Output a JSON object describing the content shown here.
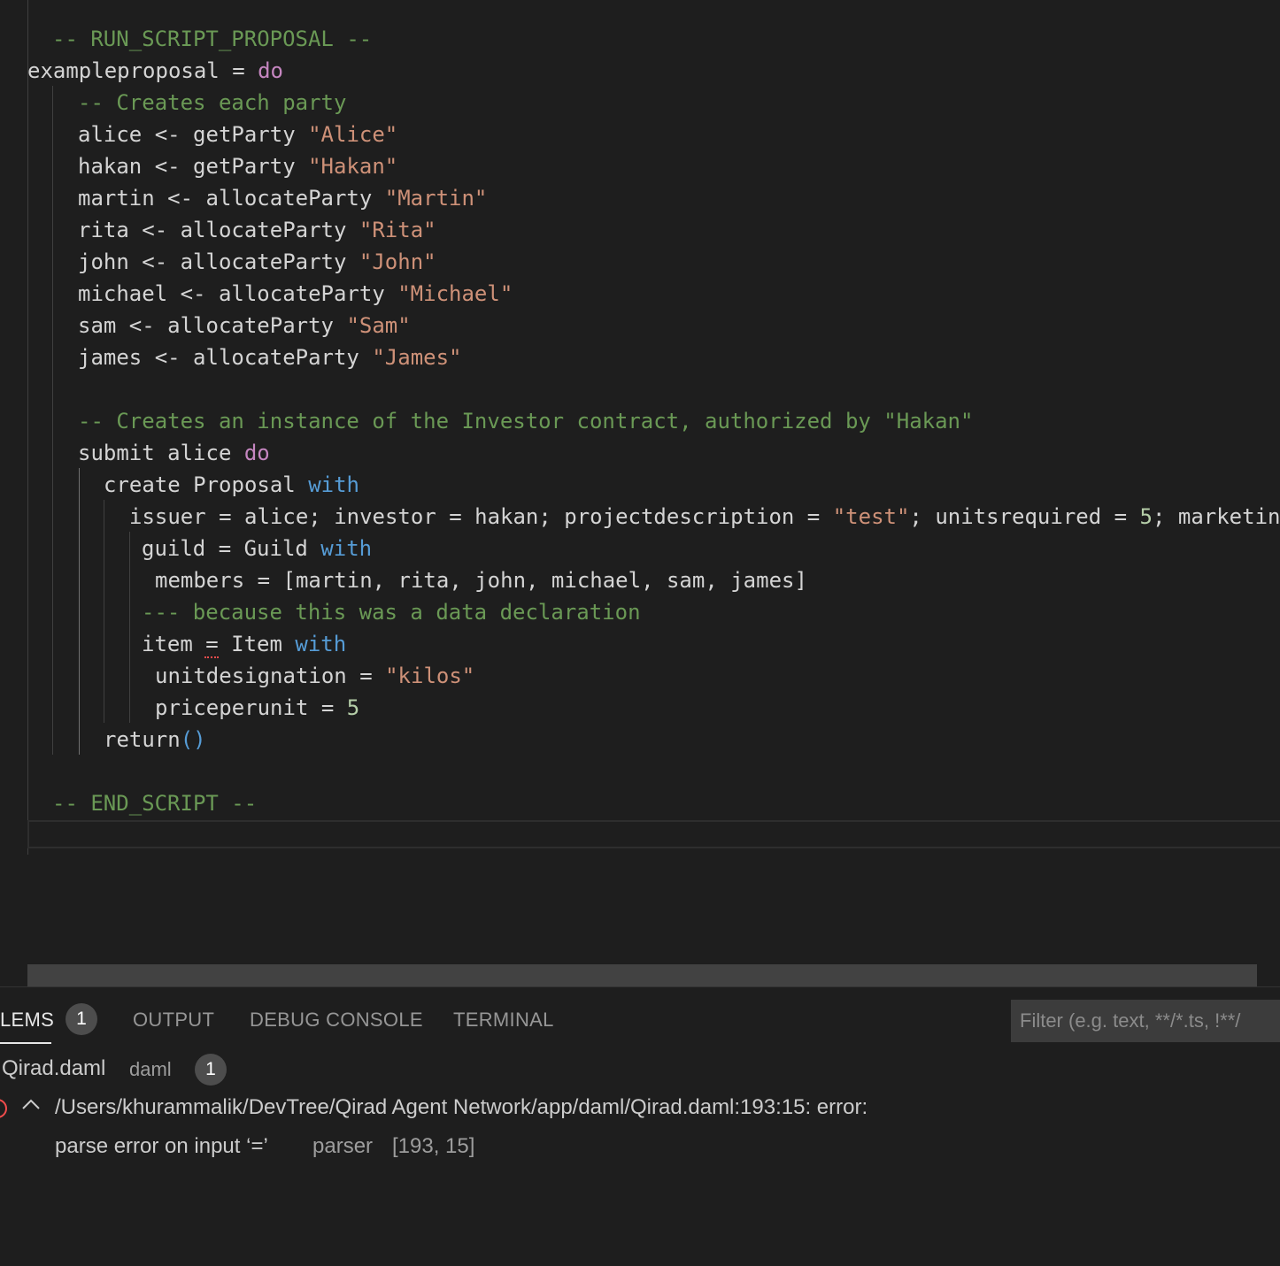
{
  "editor": {
    "lines": [
      {
        "segments": [
          {
            "t": "-- RUN_SCRIPT_PROPOSAL --",
            "c": "c"
          }
        ]
      },
      {
        "segments": [
          {
            "t": "exampleproposal = ",
            "c": ""
          },
          {
            "t": "do",
            "c": "kw"
          }
        ]
      },
      {
        "segments": [
          {
            "t": "-- Creates each party",
            "c": "c"
          }
        ]
      },
      {
        "segments": [
          {
            "t": "alice <- getParty ",
            "c": ""
          },
          {
            "t": "\"Alice\"",
            "c": "s"
          }
        ]
      },
      {
        "segments": [
          {
            "t": "hakan <- getParty ",
            "c": ""
          },
          {
            "t": "\"Hakan\"",
            "c": "s"
          }
        ]
      },
      {
        "segments": [
          {
            "t": "martin <- allocateParty ",
            "c": ""
          },
          {
            "t": "\"Martin\"",
            "c": "s"
          }
        ]
      },
      {
        "segments": [
          {
            "t": "rita <- allocateParty ",
            "c": ""
          },
          {
            "t": "\"Rita\"",
            "c": "s"
          }
        ]
      },
      {
        "segments": [
          {
            "t": "john <- allocateParty ",
            "c": ""
          },
          {
            "t": "\"John\"",
            "c": "s"
          }
        ]
      },
      {
        "segments": [
          {
            "t": "michael <- allocateParty ",
            "c": ""
          },
          {
            "t": "\"Michael\"",
            "c": "s"
          }
        ]
      },
      {
        "segments": [
          {
            "t": "sam <- allocateParty ",
            "c": ""
          },
          {
            "t": "\"Sam\"",
            "c": "s"
          }
        ]
      },
      {
        "segments": [
          {
            "t": "james <- allocateParty ",
            "c": ""
          },
          {
            "t": "\"James\"",
            "c": "s"
          }
        ]
      },
      {
        "segments": []
      },
      {
        "segments": [
          {
            "t": "-- Creates an instance of the Investor contract, authorized by \"Hakan\"",
            "c": "c"
          }
        ]
      },
      {
        "segments": [
          {
            "t": "submit alice ",
            "c": ""
          },
          {
            "t": "do",
            "c": "kw"
          }
        ]
      },
      {
        "segments": [
          {
            "t": "create Proposal ",
            "c": ""
          },
          {
            "t": "with",
            "c": "kb"
          }
        ]
      },
      {
        "segments": [
          {
            "t": "issuer = alice; investor = hakan; projectdescription = ",
            "c": ""
          },
          {
            "t": "\"test\"",
            "c": "s"
          },
          {
            "t": "; unitsrequired = ",
            "c": ""
          },
          {
            "t": "5",
            "c": "n"
          },
          {
            "t": "; marketing",
            "c": ""
          }
        ]
      },
      {
        "segments": [
          {
            "t": "guild = Guild ",
            "c": ""
          },
          {
            "t": "with",
            "c": "kb"
          }
        ]
      },
      {
        "segments": [
          {
            "t": "members = [martin, rita, john, michael, sam, james]",
            "c": ""
          }
        ]
      },
      {
        "segments": [
          {
            "t": "--- because this was a data declaration",
            "c": "c"
          }
        ]
      },
      {
        "segments": [
          {
            "t": "item = Item ",
            "c": ""
          },
          {
            "t": "with",
            "c": "kb"
          }
        ]
      },
      {
        "segments": [
          {
            "t": "unitdesignation = ",
            "c": ""
          },
          {
            "t": "\"kilos\"",
            "c": "s"
          }
        ]
      },
      {
        "segments": [
          {
            "t": "priceperunit = ",
            "c": ""
          },
          {
            "t": "5",
            "c": "n"
          }
        ]
      },
      {
        "segments": [
          {
            "t": "return",
            "c": ""
          },
          {
            "t": "()",
            "c": "kb"
          }
        ]
      },
      {
        "segments": []
      },
      {
        "segments": [
          {
            "t": "-- END_SCRIPT --",
            "c": "c"
          }
        ]
      }
    ]
  },
  "panel": {
    "tabs": [
      {
        "label": "LEMS",
        "active": true
      },
      {
        "label": "OUTPUT",
        "active": false
      },
      {
        "label": "DEBUG CONSOLE",
        "active": false
      },
      {
        "label": "TERMINAL",
        "active": false
      }
    ],
    "problems_count": "1",
    "filter_placeholder": "Filter (e.g. text, **/*.ts, !**/",
    "file": {
      "name": "Qirad.daml",
      "language": "daml",
      "count": "1"
    },
    "problem": {
      "path": "/Users/khurammalik/DevTree/Qirad Agent Network/app/daml/Qirad.daml:193:15: error:",
      "message": "parse error on input ‘=’",
      "source": "parser",
      "position": "[193, 15]"
    }
  }
}
